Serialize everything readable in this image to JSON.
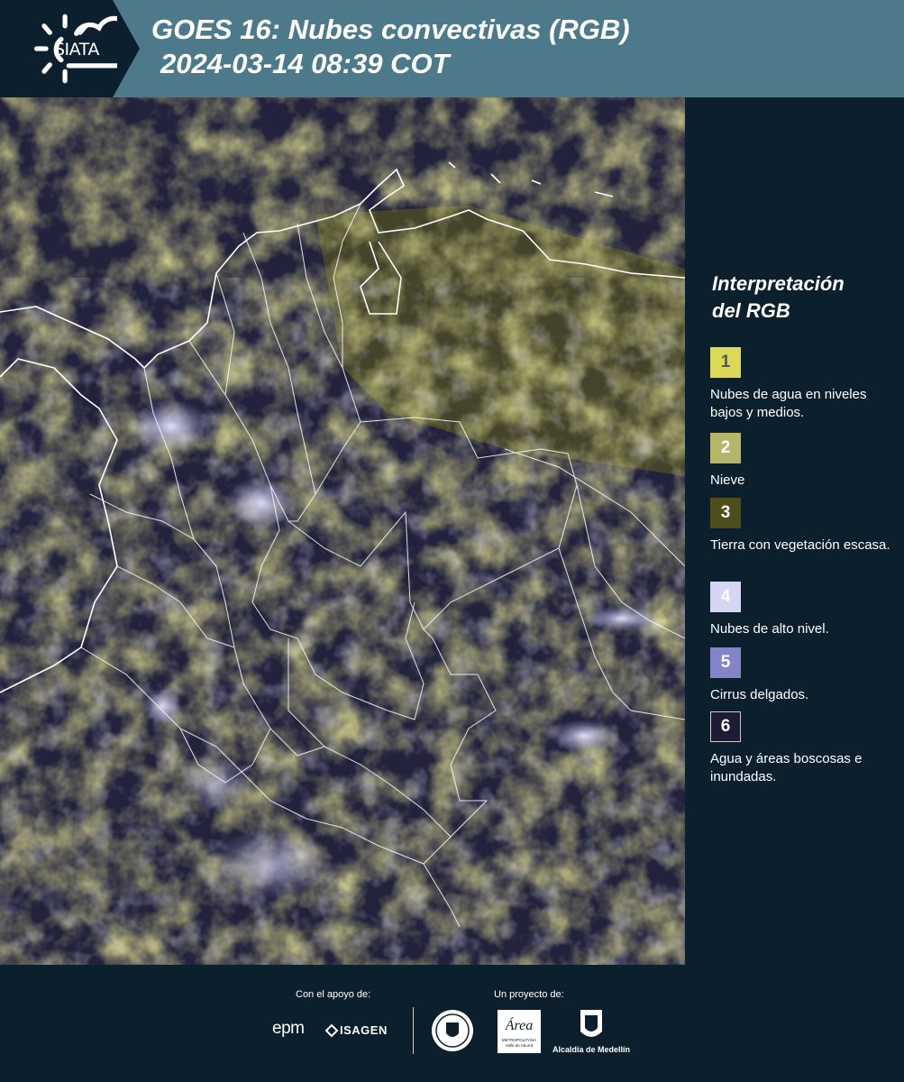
{
  "header": {
    "logo_text": "SIATA",
    "title_line1": "GOES 16: Nubes convectivas (RGB)",
    "title_line2": "2024-03-14 08:39 COT"
  },
  "legend": {
    "title_line1": "Interpretación",
    "title_line2": "del RGB",
    "items": [
      {
        "number": "1",
        "label": "Nubes de agua en niveles bajos y medios.",
        "color": "#dcd858"
      },
      {
        "number": "2",
        "label": "Nieve",
        "color": "#b6b66a"
      },
      {
        "number": "3",
        "label": "Tierra con vegetación escasa.",
        "color": "#4e4e1c"
      },
      {
        "number": "4",
        "label": "Nubes de alto nivel.",
        "color": "#d6d6f4"
      },
      {
        "number": "5",
        "label": "Cirrus delgados.",
        "color": "#8484c8"
      },
      {
        "number": "6",
        "label": "Agua y áreas boscosas e inundadas.",
        "color": "#1c1c34"
      }
    ]
  },
  "footer": {
    "support_label": "Con el apoyo de:",
    "project_label": "Un proyecto de:",
    "sponsor_epm": "epm",
    "sponsor_isagen": "ISAGEN",
    "sponsor_area": "Área",
    "sponsor_area_sub": "METROPOLITANA Valle de Aburrá",
    "sponsor_alcaldia": "Alcaldía de Medellín"
  }
}
